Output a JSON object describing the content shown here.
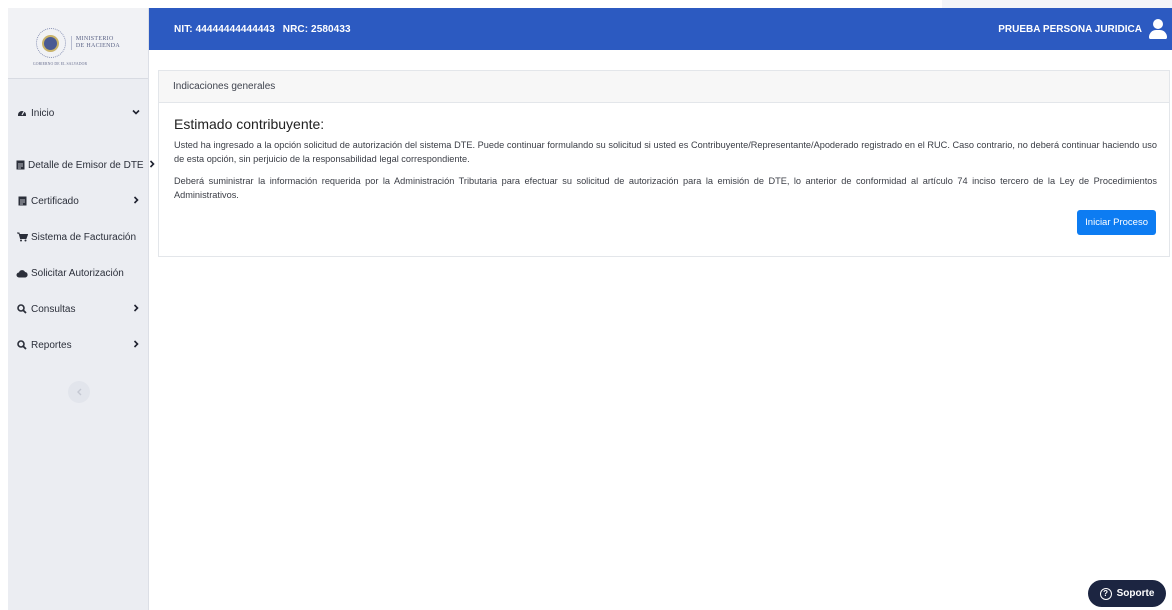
{
  "brand": {
    "logo_text_line1": "MINISTERIO",
    "logo_text_line2": "DE HACIENDA",
    "seal_caption": "GOBIERNO DE EL SALVADOR"
  },
  "sidebar": {
    "items": [
      {
        "label": "Inicio",
        "icon": "dashboard-icon",
        "arrow": "chevron-down"
      },
      {
        "label": "Detalle de Emisor de DTE",
        "icon": "document-icon",
        "arrow": "chevron-right"
      },
      {
        "label": "Certificado",
        "icon": "document-icon",
        "arrow": "chevron-right"
      },
      {
        "label": "Sistema de Facturación",
        "icon": "cart-icon",
        "arrow": ""
      },
      {
        "label": "Solicitar Autorización",
        "icon": "cloud-icon",
        "arrow": ""
      },
      {
        "label": "Consultas",
        "icon": "search-icon",
        "arrow": "chevron-right"
      },
      {
        "label": "Reportes",
        "icon": "search-icon",
        "arrow": "chevron-right"
      }
    ]
  },
  "topbar": {
    "nit": "NIT: 44444444444443",
    "nrc": "NRC: 2580433",
    "user_name": "PRUEBA PERSONA JURIDICA",
    "accent_color": "#2c5ac1"
  },
  "card": {
    "header": "Indicaciones generales",
    "title": "Estimado contribuyente:",
    "paragraph1": "Usted ha ingresado a la opción solicitud de autorización del sistema DTE. Puede continuar formulando su solicitud si usted es Contribuyente/Representante/Apoderado registrado en el RUC. Caso contrario, no deberá continuar haciendo uso de esta opción, sin perjuicio de la responsabilidad legal correspondiente.",
    "paragraph2": "Deberá suministrar la información requerida por la Administración Tributaria para efectuar su solicitud de autorización para la emisión de DTE, lo anterior de conformidad al artículo 74 inciso tercero de la Ley de Procedimientos Administrativos.",
    "button_label": "Iniciar Proceso",
    "button_color": "#0d7cf2"
  },
  "support": {
    "label": "Soporte"
  }
}
